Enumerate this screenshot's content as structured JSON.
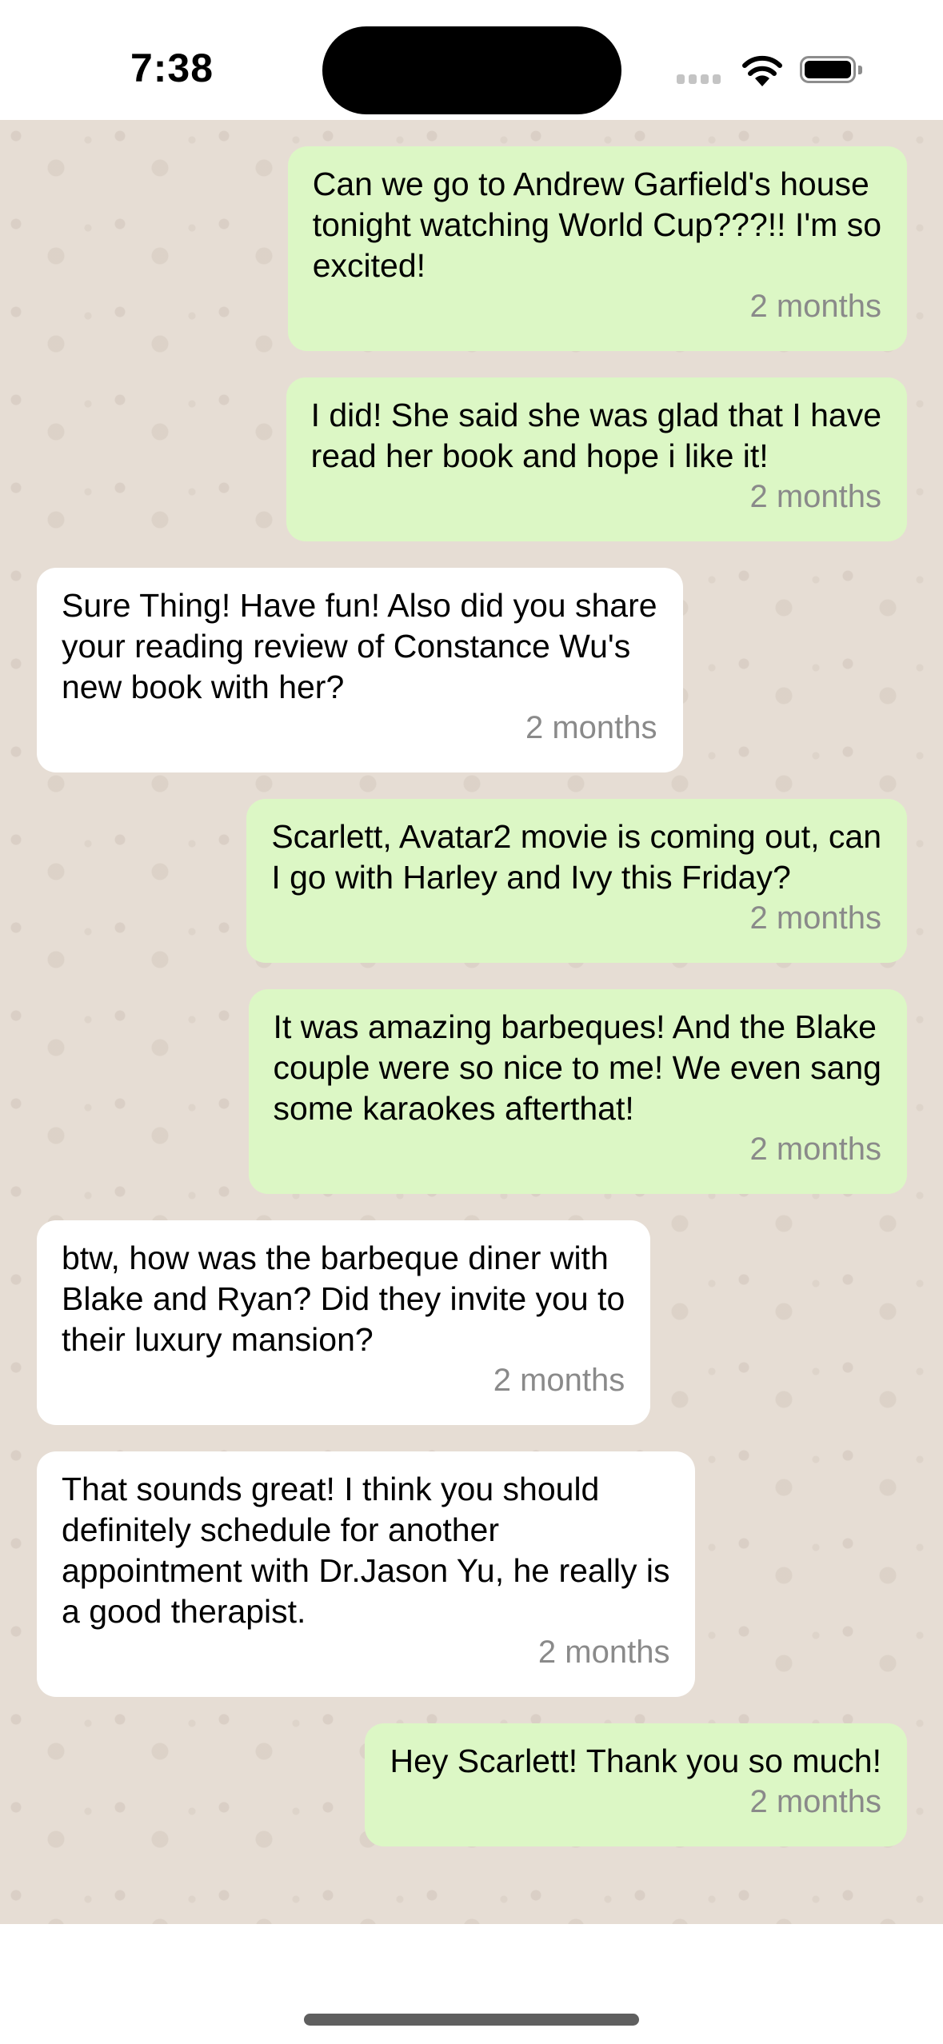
{
  "status_bar": {
    "time": "7:38",
    "icons": [
      "signal-icon",
      "wifi-icon",
      "battery-icon"
    ]
  },
  "colors": {
    "outgoing_bubble": "#dcf7c5",
    "incoming_bubble": "#ffffff",
    "chat_background": "#e6ddd4",
    "timestamp": "#8a8a8a"
  },
  "messages": [
    {
      "direction": "outgoing",
      "lines": [
        "Can we go to Andrew Garfield's house",
        "tonight watching World Cup???!! I'm so",
        "excited!"
      ],
      "time": "2 months"
    },
    {
      "direction": "outgoing",
      "lines": [
        "I did! She said she was glad that I have",
        "read her book and hope i like it!"
      ],
      "time": "2 months"
    },
    {
      "direction": "incoming",
      "lines": [
        "Sure Thing! Have fun! Also did you share",
        "your reading review of Constance Wu's",
        "new book with her?"
      ],
      "time": "2 months"
    },
    {
      "direction": "outgoing",
      "lines": [
        "Scarlett, Avatar2 movie is coming out, can",
        "I go with Harley and Ivy this Friday?"
      ],
      "time": "2 months"
    },
    {
      "direction": "outgoing",
      "lines": [
        "It was amazing barbeques! And the Blake",
        "couple were so nice to me! We even sang",
        "some karaokes afterthat!"
      ],
      "time": "2 months"
    },
    {
      "direction": "incoming",
      "lines": [
        "btw, how was the barbeque diner with",
        "Blake and Ryan? Did they invite you to",
        "their luxury mansion?"
      ],
      "time": "2 months"
    },
    {
      "direction": "incoming",
      "lines": [
        "That sounds great! I think you should",
        "definitely schedule for another",
        "appointment with Dr.Jason Yu, he really is",
        "a good therapist."
      ],
      "time": "2 months"
    },
    {
      "direction": "outgoing",
      "lines": [
        "Hey Scarlett! Thank you so much!"
      ],
      "time": "2 months"
    }
  ]
}
